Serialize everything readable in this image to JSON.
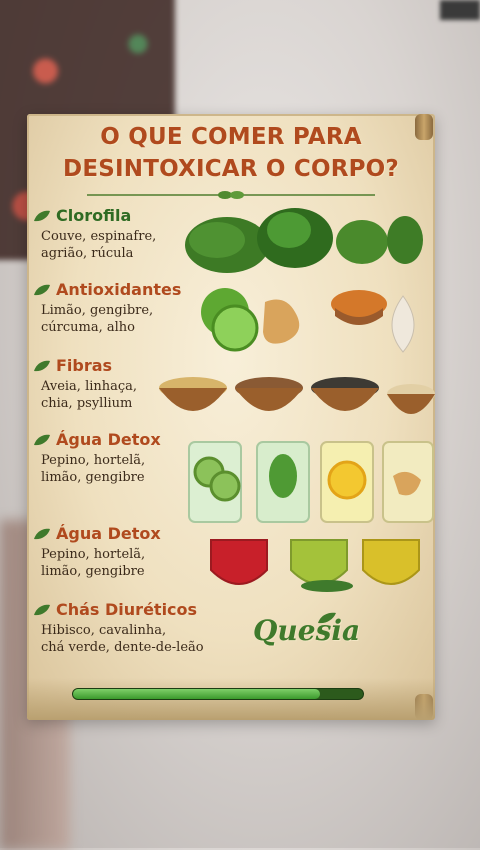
{
  "poster": {
    "title_line1": "O QUE COMER PARA",
    "title_line2": "DESINTOXICAR O CORPO?",
    "sections": [
      {
        "heading": "Clorofila",
        "text": "Couve, espinafre,\nagrião, rúcula",
        "color": "#2f6b23"
      },
      {
        "heading": "Antioxidantes",
        "text": "Limão, gengibre,\ncúrcuma, alho",
        "color": "#b04a1e"
      },
      {
        "heading": "Fibras",
        "text": "Aveia, linhaça,\nchia, psyllium",
        "color": "#b04a1e"
      },
      {
        "heading": "Água Detox",
        "text": "Pepino, hortelã,\nlimão, gengibre",
        "color": "#b04a1e"
      },
      {
        "heading": "Água Detox",
        "text": "Pepino, hortelã,\nlimão, gengibre",
        "color": "#b04a1e"
      },
      {
        "heading": "Chás Diuréticos",
        "text": "Hibisco, cavalinha,\nchá verde, dente-de-leão",
        "color": "#b04a1e"
      }
    ],
    "brand": "Quesia",
    "progress": 0.85
  },
  "colors": {
    "title": "#b04a1e",
    "leaf": "#3f7a2c",
    "progress": "#3b9a2c"
  }
}
